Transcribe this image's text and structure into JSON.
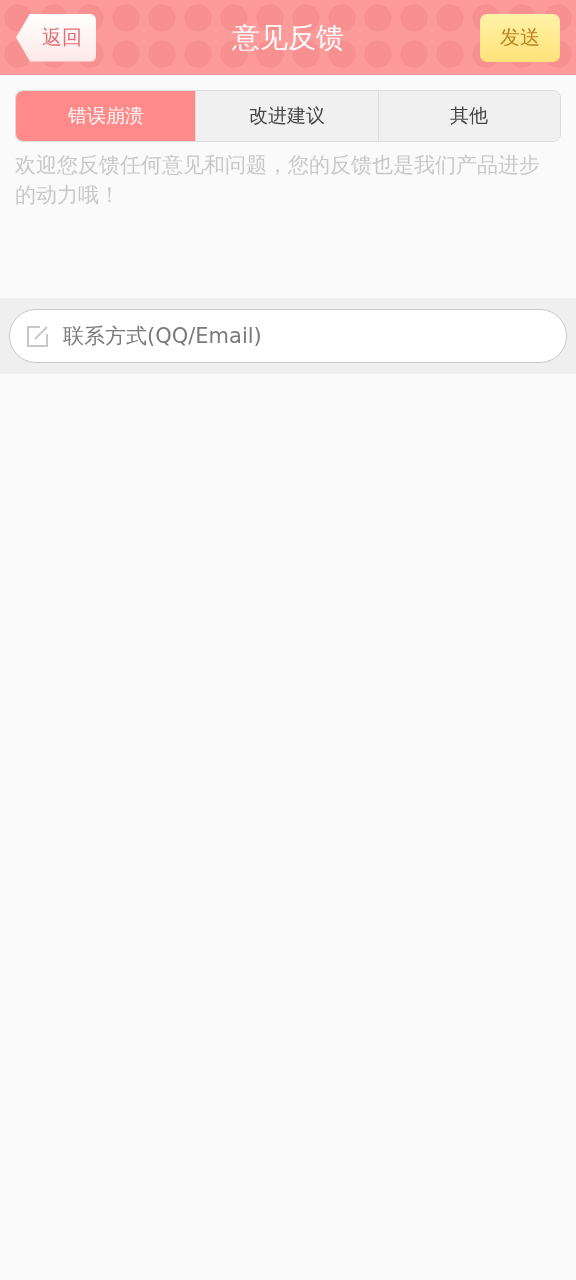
{
  "header": {
    "back": "返回",
    "title": "意见反馈",
    "send": "发送"
  },
  "tabs": [
    {
      "label": "错误崩溃",
      "selected": true
    },
    {
      "label": "改进建议",
      "selected": false
    },
    {
      "label": "其他",
      "selected": false
    }
  ],
  "feedback": {
    "placeholder": "欢迎您反馈任何意见和问题，您的反馈也是我们产品进步的动力哦！"
  },
  "contact": {
    "placeholder": "联系方式(QQ/Email)"
  }
}
